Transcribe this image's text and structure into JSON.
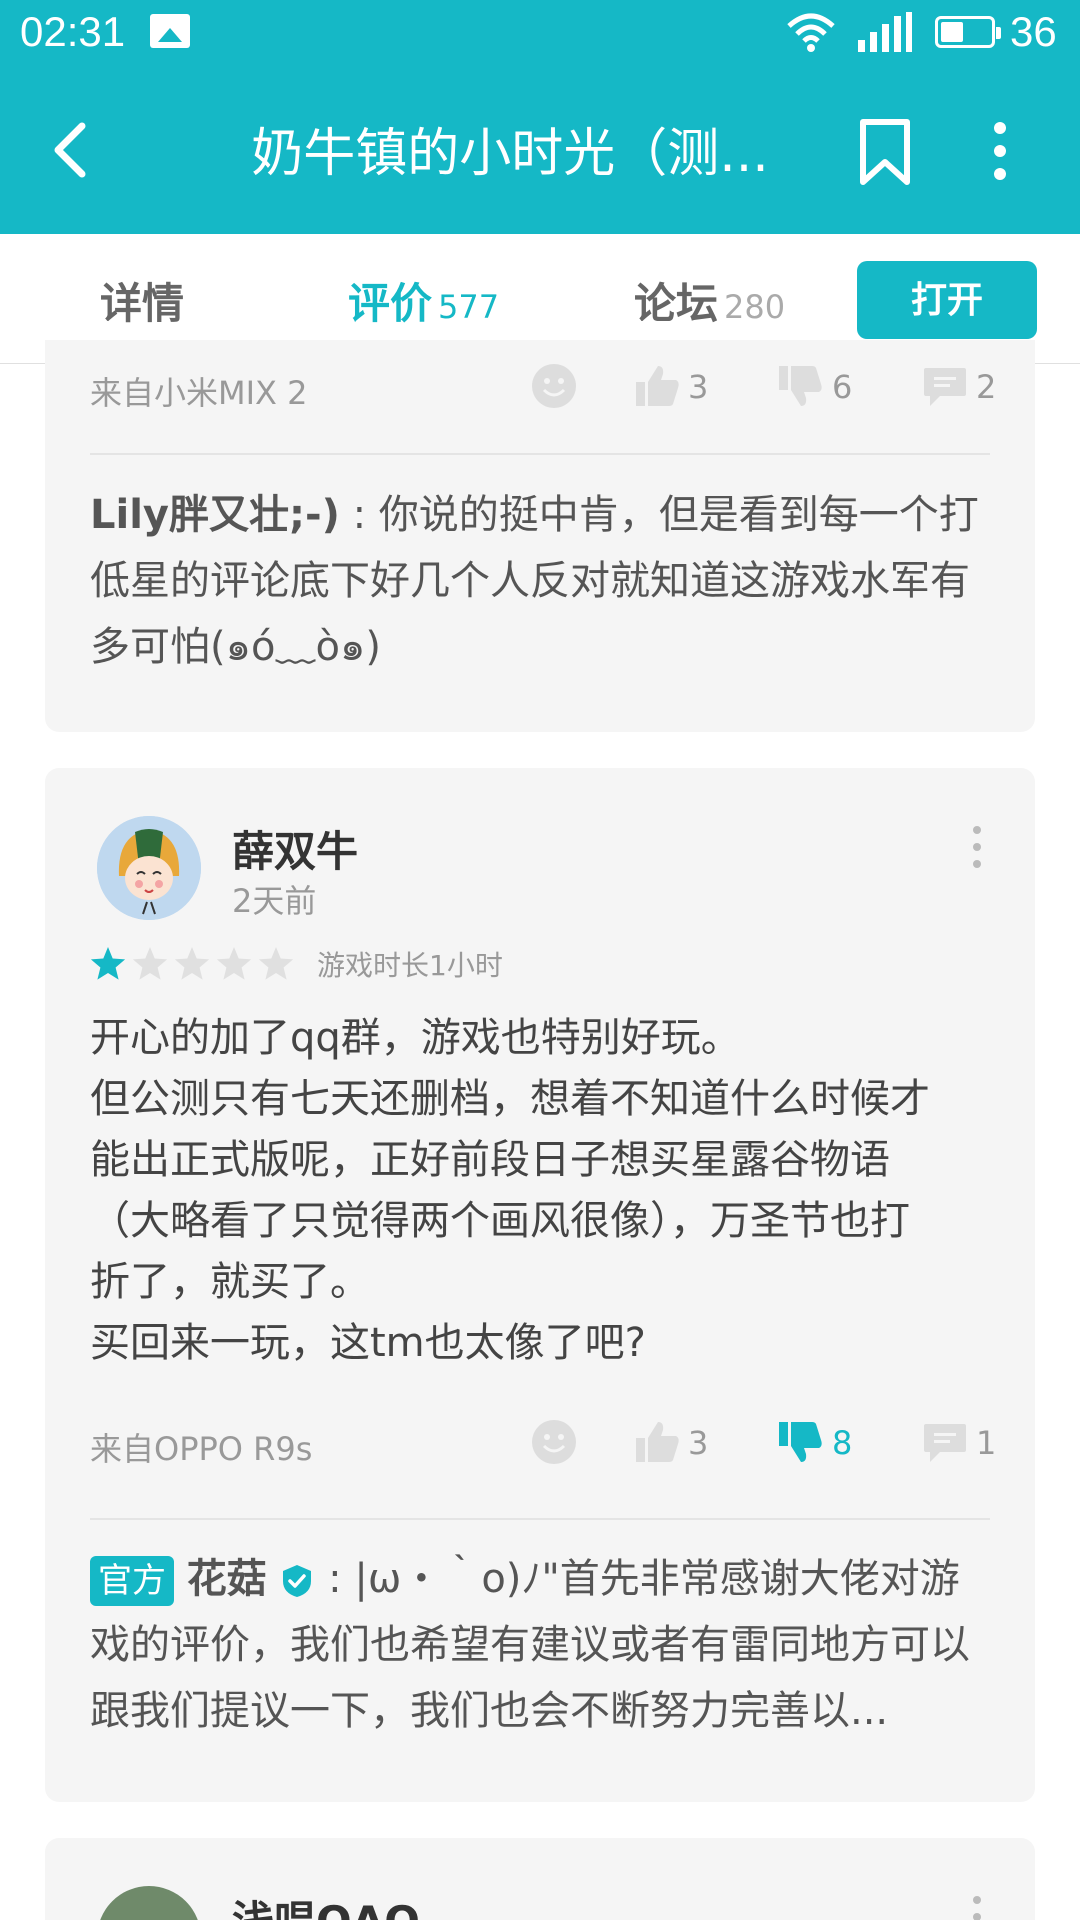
{
  "status_bar": {
    "time": "02:31",
    "battery": "36"
  },
  "app_bar": {
    "title": "奶牛镇的小时光（测..."
  },
  "tabs": [
    {
      "label": "详情",
      "count": ""
    },
    {
      "label": "评价",
      "count": "577"
    },
    {
      "label": "论坛",
      "count": "280"
    }
  ],
  "open_button": "打开",
  "card1": {
    "device": "来自小米MIX 2",
    "likes": "3",
    "dislikes": "6",
    "comments": "2",
    "reply_user": "Lily胖又壮;-)",
    "reply_text": " : 你说的挺中肯，但是看到每一个打低星的评论底下好几个人反对就知道这游戏水军有多可怕(๑ó﹏ò๑)"
  },
  "card2": {
    "username": "薛双牛",
    "time": "2天前",
    "rating": 1,
    "max_rating": 5,
    "playtime": "游戏时长1小时",
    "body_lines": [
      "开心的加了qq群，游戏也特别好玩。",
      "但公测只有七天还删档，想着不知道什么时候才",
      "能出正式版呢，正好前段日子想买星露谷物语",
      "（大略看了只觉得两个画风很像），万圣节也打",
      "折了，就买了。",
      "买回来一玩，这tm也太像了吧?"
    ],
    "device": "来自OPPO R9s",
    "likes": "3",
    "dislikes": "8",
    "comments": "1",
    "reply_tag": "官方",
    "reply_user": "花菇",
    "reply_text": " : |ω・｀o)ﾉ\"首先非常感谢大佬对游戏的评价，我们也希望有建议或者有雷同地方可以跟我们提议一下，我们也会不断努力完善以..."
  },
  "card3": {
    "username": "浅唱QAQ"
  },
  "colors": {
    "accent": "#15b8c6",
    "card_bg": "#f5f5f5"
  }
}
